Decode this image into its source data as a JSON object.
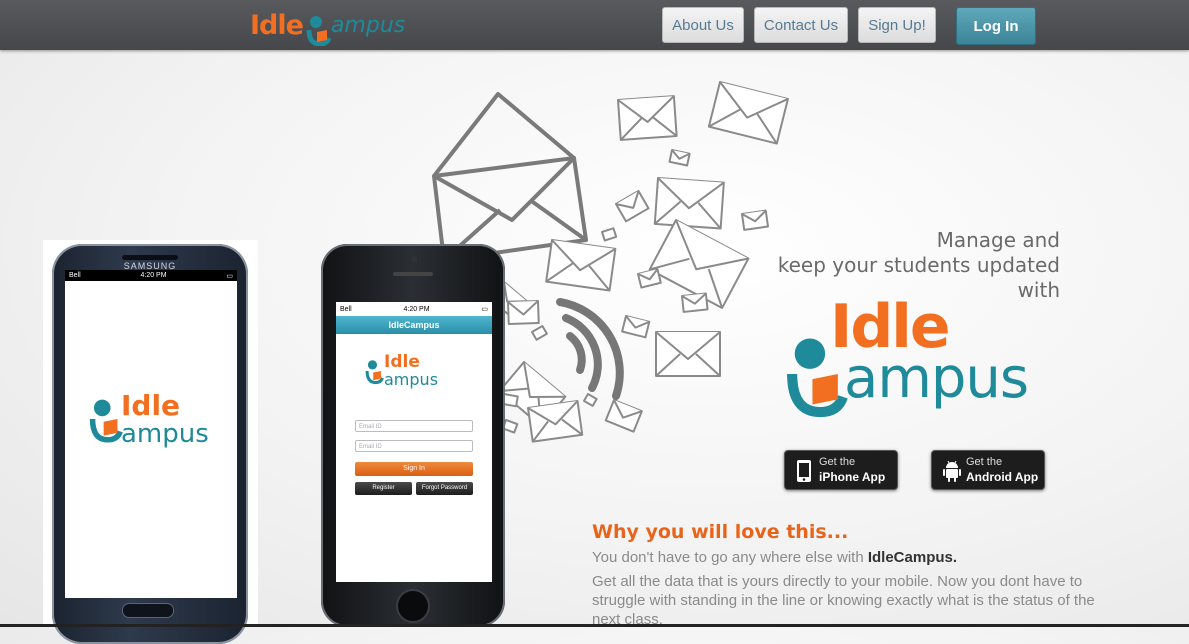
{
  "header": {
    "logo": {
      "idle": "Idle",
      "campus": "ampus"
    },
    "nav": {
      "about": "About Us",
      "contact": "Contact Us",
      "signup": "Sign Up!",
      "login": "Log In"
    }
  },
  "phones": {
    "samsung": {
      "brand": "SAMSUNG",
      "carrier": "Bell",
      "time": "4:20 PM",
      "logo_idle": "Idle",
      "logo_campus": "ampus"
    },
    "iphone": {
      "carrier": "Bell",
      "time": "4:20 PM",
      "app_title": "IdleCampus",
      "logo_idle": "Idle",
      "logo_campus": "ampus",
      "email_placeholder": "Email ID",
      "password_placeholder": "Email ID",
      "signin": "Sign In",
      "register": "Register",
      "forgot": "Forgot Password"
    }
  },
  "hero": {
    "tagline_1": "Manage and",
    "tagline_2": "keep your students updated",
    "tagline_3": "with",
    "logo_idle": "Idle",
    "logo_campus": "ampus"
  },
  "stores": {
    "iphone": {
      "small": "Get the",
      "big": "iPhone App"
    },
    "android": {
      "small": "Get the",
      "big": "Android App"
    }
  },
  "why": {
    "title": "Why you will love this...",
    "line_prefix": "You don't have to go any where else with ",
    "line_brand": "IdleCampus.",
    "paragraph": "Get all the data that is yours directly to your mobile. Now you dont have to struggle with standing in the line or knowing exactly what is the status of the next class."
  },
  "colors": {
    "orange": "#f26f21",
    "teal": "#1f8a9a",
    "topbar": "#4d4f52",
    "login": "#4a97ab"
  }
}
